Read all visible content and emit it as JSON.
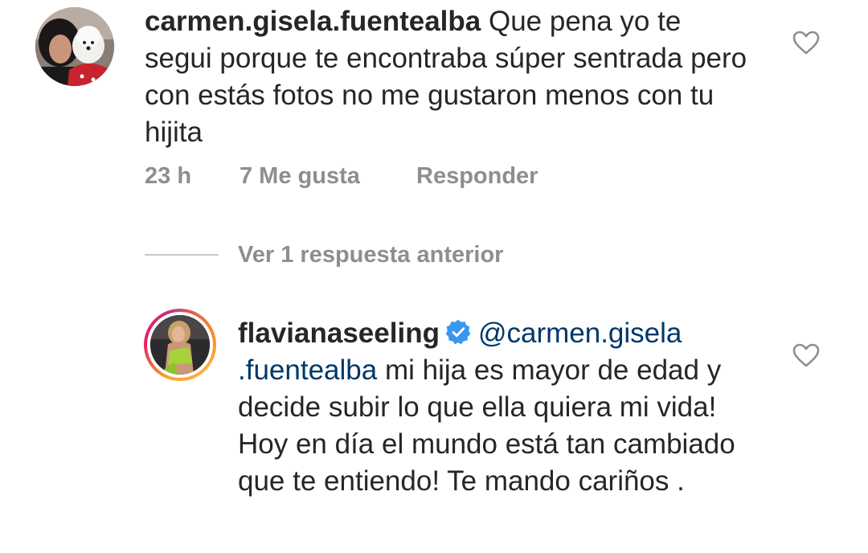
{
  "comments": [
    {
      "username": "carmen.gisela.fuentealba",
      "text": "Que pena yo te segui porque te encontraba súper sentrada pero con estás fotos no me gustaron menos con tu hijita",
      "time": "23 h",
      "likes": "7 Me gusta",
      "reply_label": "Responder",
      "avatar_icon": "user-avatar-with-dog"
    }
  ],
  "view_replies_label": "Ver 1 respuesta anterior",
  "reply": {
    "username": "flavianaseeling",
    "verified": true,
    "mention_part1": "@carmen.gisela",
    "mention_part2": ".fuentealba",
    "text": "mi hija es mayor de edad y decide subir lo que ella quiera mi vida! Hoy en día el mundo está tan cambiado que te entiendo! Te mando cariños .",
    "avatar_icon": "story-ring-avatar"
  },
  "colors": {
    "text": "#262626",
    "muted": "#8e8e8e",
    "mention": "#00376b",
    "verified": "#3897f0"
  },
  "icons": {
    "like": "heart-outline-icon",
    "verified": "verified-badge-icon"
  }
}
